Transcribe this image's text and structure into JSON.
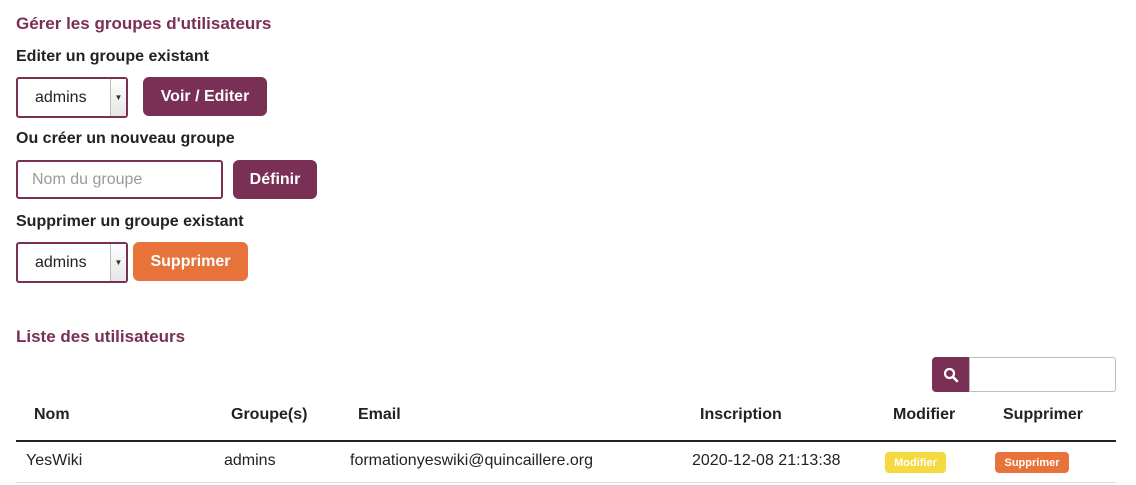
{
  "groups_section": {
    "title": "Gérer les groupes d'utilisateurs",
    "edit": {
      "label": "Editer un groupe existant",
      "selected": "admins",
      "button": "Voir / Editer"
    },
    "create": {
      "label": "Ou créer un nouveau groupe",
      "placeholder": "Nom du groupe",
      "button": "Définir"
    },
    "delete": {
      "label": "Supprimer un groupe existant",
      "selected": "admins",
      "button": "Supprimer"
    }
  },
  "users_section": {
    "title": "Liste des utilisateurs",
    "search": {
      "icon": "search-icon",
      "value": ""
    },
    "table": {
      "headers": [
        "Nom",
        "Groupe(s)",
        "Email",
        "Inscription",
        "Modifier",
        "Supprimer"
      ],
      "rows": [
        {
          "name": "YesWiki",
          "groups": "admins",
          "email": "formationyeswiki@quincaillere.org",
          "registered": "2020-12-08 21:13:38",
          "edit_label": "Modifier",
          "delete_label": "Supprimer"
        }
      ]
    }
  },
  "colors": {
    "primary": "#7a2f55",
    "danger": "#e8733a",
    "warning": "#f4d93f"
  }
}
